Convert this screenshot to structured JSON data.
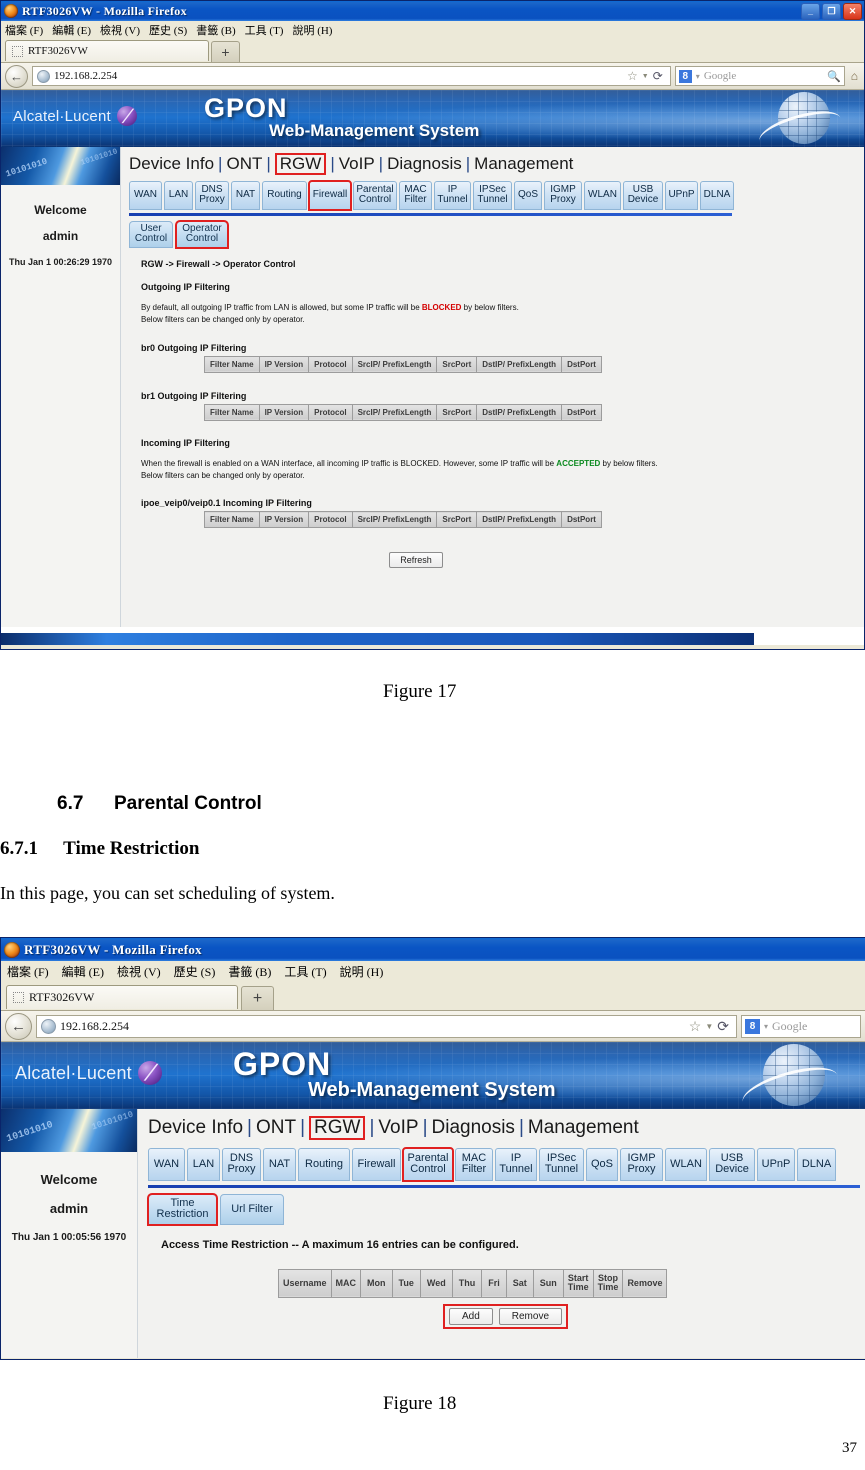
{
  "document": {
    "figure17_caption": "Figure 17",
    "section_number": "6.7",
    "section_title": "Parental Control",
    "subsection_number": "6.7.1",
    "subsection_title": "Time Restriction",
    "body_text": "In this page, you can set scheduling of system.",
    "figure18_caption": "Figure 18",
    "page_number": "37"
  },
  "browser": {
    "window_title": "RTF3026VW - Mozilla Firefox",
    "menu_items": [
      "檔案 (F)",
      "編輯 (E)",
      "檢視 (V)",
      "歷史 (S)",
      "書籤 (B)",
      "工具 (T)",
      "說明 (H)"
    ],
    "tab_label": "RTF3026VW",
    "new_tab_label": "+",
    "url": "192.168.2.254",
    "search_placeholder": "Google",
    "search_engine_badge": "8",
    "back_glyph": "←",
    "bookmark_glyph": "☆",
    "dropdown_glyph": "▼",
    "reload_glyph": "⟳",
    "home_glyph": "⌂",
    "magnifier_glyph": "ὐD",
    "minimize_glyph": "_",
    "maximize_glyph": "❐",
    "close_glyph": "✕"
  },
  "gpon": {
    "brand": "Alcatel·Lucent",
    "brand_mark": "↗",
    "title_main": "GPON",
    "title_sub": "Web-Management System",
    "sidebar": {
      "welcome": "Welcome",
      "user": "admin",
      "binary": "10101010"
    },
    "top_nav": [
      "Device Info",
      "ONT",
      "RGW",
      "VoIP",
      "Diagnosis",
      "Management"
    ],
    "top_nav_selected": "RGW",
    "nav_tabs": [
      {
        "l1": "WAN",
        "l2": ""
      },
      {
        "l1": "LAN",
        "l2": ""
      },
      {
        "l1": "DNS",
        "l2": "Proxy"
      },
      {
        "l1": "NAT",
        "l2": ""
      },
      {
        "l1": "Routing",
        "l2": ""
      },
      {
        "l1": "Firewall",
        "l2": ""
      },
      {
        "l1": "Parental",
        "l2": "Control"
      },
      {
        "l1": "MAC",
        "l2": "Filter"
      },
      {
        "l1": "IP",
        "l2": "Tunnel"
      },
      {
        "l1": "IPSec",
        "l2": "Tunnel"
      },
      {
        "l1": "QoS",
        "l2": ""
      },
      {
        "l1": "IGMP",
        "l2": "Proxy"
      },
      {
        "l1": "WLAN",
        "l2": ""
      },
      {
        "l1": "USB",
        "l2": "Device"
      },
      {
        "l1": "UPnP",
        "l2": ""
      },
      {
        "l1": "DLNA",
        "l2": ""
      }
    ]
  },
  "shot1": {
    "datetime": "Thu Jan 1 00:26:29 1970",
    "selected_nav_tab": "Firewall",
    "sub_tabs": [
      {
        "l1": "User",
        "l2": "Control"
      },
      {
        "l1": "Operator",
        "l2": "Control"
      }
    ],
    "sub_tab_selected": "Operator Control",
    "breadcrumb": "RGW -> Firewall -> Operator Control",
    "outgoing_heading": "Outgoing IP Filtering",
    "outgoing_desc_pre": "By default, all outgoing IP traffic from LAN is allowed, but some IP traffic will be ",
    "outgoing_desc_kw": "BLOCKED",
    "outgoing_desc_post": " by below filters.",
    "outgoing_desc_line2": "Below filters can be changed only by operator.",
    "br0_caption": "br0 Outgoing IP Filtering",
    "br1_caption": "br1 Outgoing IP Filtering",
    "incoming_heading": "Incoming IP Filtering",
    "incoming_desc_pre": "When the firewall is enabled on a WAN interface, all incoming IP traffic is BLOCKED. However, some IP traffic will be ",
    "incoming_desc_kw": "ACCEPTED",
    "incoming_desc_post": " by below filters.",
    "incoming_desc_line2": "Below filters can be changed only by operator.",
    "ipoe_caption": "ipoe_veip0/veip0.1 Incoming IP Filtering",
    "filter_columns": [
      "Filter Name",
      "IP Version",
      "Protocol",
      "SrcIP/ PrefixLength",
      "SrcPort",
      "DstIP/ PrefixLength",
      "DstPort"
    ],
    "refresh_button": "Refresh"
  },
  "shot2": {
    "datetime": "Thu Jan 1 00:05:56 1970",
    "selected_nav_tab": "Parental Control",
    "sub_tabs": [
      {
        "l1": "Time",
        "l2": "Restriction"
      },
      {
        "l1": "Url Filter",
        "l2": ""
      }
    ],
    "sub_tab_selected": "Time Restriction",
    "table_caption": "Access Time Restriction -- A maximum 16 entries can be configured.",
    "table_columns": [
      {
        "l1": "Username",
        "l2": ""
      },
      {
        "l1": "MAC",
        "l2": ""
      },
      {
        "l1": "Mon",
        "l2": ""
      },
      {
        "l1": "Tue",
        "l2": ""
      },
      {
        "l1": "Wed",
        "l2": ""
      },
      {
        "l1": "Thu",
        "l2": ""
      },
      {
        "l1": "Fri",
        "l2": ""
      },
      {
        "l1": "Sat",
        "l2": ""
      },
      {
        "l1": "Sun",
        "l2": ""
      },
      {
        "l1": "Start",
        "l2": "Time"
      },
      {
        "l1": "Stop",
        "l2": "Time"
      },
      {
        "l1": "Remove",
        "l2": ""
      }
    ],
    "add_button": "Add",
    "remove_button": "Remove"
  },
  "colors": {
    "accent_red": "#e02020",
    "brand_blue": "#1356ab",
    "blocked": "#d40000",
    "accepted": "#0a8a1e"
  }
}
